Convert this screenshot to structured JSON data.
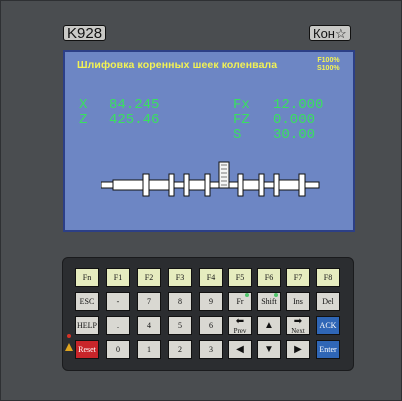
{
  "header": {
    "model": "K928",
    "brand": "Кон☆"
  },
  "screen": {
    "title": "Шлифовка коренных шеек коленвала",
    "feed_f": "F100%",
    "feed_s": "S100%",
    "axes": [
      {
        "label": "X",
        "value": "84.245"
      },
      {
        "label": "Z",
        "value": "425.46"
      }
    ],
    "params": [
      {
        "label": "Fx",
        "value": "12.000"
      },
      {
        "label": "FZ",
        "value": "0.000"
      },
      {
        "label": "S",
        "value": "30.00"
      }
    ]
  },
  "colors": {
    "screen_bg": "#6d86c4",
    "text_yellow": "#f3f353",
    "text_green": "#39e05f",
    "reset_red": "#c8252a",
    "ack_blue": "#2f66b6"
  },
  "keys": {
    "fn": "Fn",
    "f1": "F1",
    "f2": "F2",
    "f3": "F3",
    "f4": "F4",
    "f5": "F5",
    "f6": "F6",
    "f7": "F7",
    "f8": "F8",
    "esc": "ESC",
    "minus": "-",
    "k7": "7",
    "k8": "8",
    "k9": "9",
    "fr": "Fr",
    "shift": "Shift",
    "ins": "Ins",
    "del": "Del",
    "help": "HELP",
    "dot": ".",
    "k4": "4",
    "k5": "5",
    "k6": "6",
    "prev": "Prev",
    "up": "▲",
    "next": "Next",
    "ack": "ACK",
    "reset": "Reset",
    "k0": "0",
    "k1": "1",
    "k2": "2",
    "k3": "3",
    "left": "◀",
    "down": "▼",
    "right": "▶",
    "enter": "Enter"
  }
}
